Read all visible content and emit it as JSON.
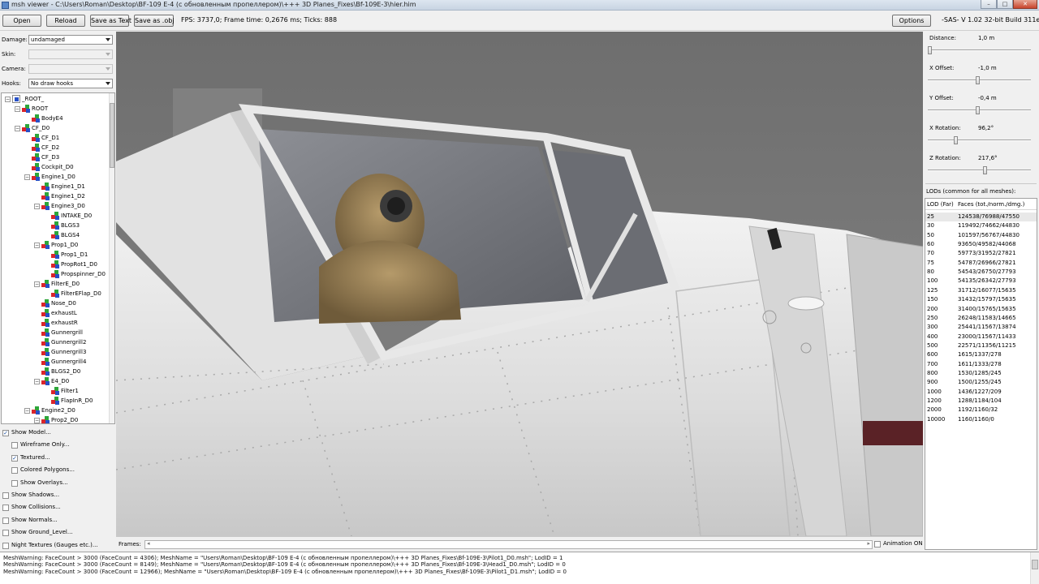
{
  "window": {
    "title": "msh viewer - C:\\Users\\Roman\\Desktop\\BF-109 E-4 (с обновленным пропеллером)\\+++ 3D Planes_Fixes\\Bf-109E-3\\hier.him",
    "minimize": "–",
    "maximize": "□",
    "close": "✕"
  },
  "toolbar": {
    "open": "Open",
    "reload": "Reload",
    "save_text": "Save as Text",
    "save_obj": "Save as .obj",
    "status": "FPS: 3737,0; Frame time: 0,2676 ms; Ticks: 888",
    "options": "Options",
    "build": "-SAS- V 1.02  32-bit  Build 311e"
  },
  "left": {
    "damage_label": "Damage:",
    "damage_value": "undamaged",
    "skin_label": "Skin:",
    "camera_label": "Camera:",
    "hooks_label": "Hooks:",
    "hooks_value": "No draw hooks",
    "tree": [
      {
        "label": "_ROOT_",
        "level": 0,
        "exp": "−",
        "root": true
      },
      {
        "label": "ROOT",
        "level": 1,
        "exp": "−"
      },
      {
        "label": "BodyE4",
        "level": 2,
        "exp": ""
      },
      {
        "label": "CF_D0",
        "level": 1,
        "exp": "−"
      },
      {
        "label": "CF_D1",
        "level": 2,
        "exp": ""
      },
      {
        "label": "CF_D2",
        "level": 2,
        "exp": ""
      },
      {
        "label": "CF_D3",
        "level": 2,
        "exp": ""
      },
      {
        "label": "Cockpit_D0",
        "level": 2,
        "exp": ""
      },
      {
        "label": "Engine1_D0",
        "level": 2,
        "exp": "−"
      },
      {
        "label": "Engine1_D1",
        "level": 3,
        "exp": ""
      },
      {
        "label": "Engine1_D2",
        "level": 3,
        "exp": ""
      },
      {
        "label": "Engine3_D0",
        "level": 3,
        "exp": "−"
      },
      {
        "label": "INTAKE_D0",
        "level": 4,
        "exp": ""
      },
      {
        "label": "BLGS3",
        "level": 4,
        "exp": ""
      },
      {
        "label": "BLGS4",
        "level": 4,
        "exp": ""
      },
      {
        "label": "Prop1_D0",
        "level": 3,
        "exp": "−"
      },
      {
        "label": "Prop1_D1",
        "level": 4,
        "exp": ""
      },
      {
        "label": "PropRot1_D0",
        "level": 4,
        "exp": ""
      },
      {
        "label": "Propspinner_D0",
        "level": 4,
        "exp": ""
      },
      {
        "label": "FilterE_D0",
        "level": 3,
        "exp": "−"
      },
      {
        "label": "FilterEFlap_D0",
        "level": 4,
        "exp": ""
      },
      {
        "label": "Nose_D0",
        "level": 3,
        "exp": ""
      },
      {
        "label": "exhaustL",
        "level": 3,
        "exp": ""
      },
      {
        "label": "exhaustR",
        "level": 3,
        "exp": ""
      },
      {
        "label": "Gunnergrill",
        "level": 3,
        "exp": ""
      },
      {
        "label": "Gunnergrill2",
        "level": 3,
        "exp": ""
      },
      {
        "label": "Gunnergrill3",
        "level": 3,
        "exp": ""
      },
      {
        "label": "Gunnergrill4",
        "level": 3,
        "exp": ""
      },
      {
        "label": "BLGS2_D0",
        "level": 3,
        "exp": ""
      },
      {
        "label": "E4_D0",
        "level": 3,
        "exp": "−"
      },
      {
        "label": "Filter1",
        "level": 4,
        "exp": ""
      },
      {
        "label": "FlapInR_D0",
        "level": 4,
        "exp": ""
      },
      {
        "label": "Engine2_D0",
        "level": 2,
        "exp": "−"
      },
      {
        "label": "Prop2_D0",
        "level": 3,
        "exp": "−"
      }
    ],
    "checks": [
      {
        "label": "Show Model...",
        "checked": true,
        "indent": 0
      },
      {
        "label": "Wireframe Only...",
        "checked": false,
        "indent": 1
      },
      {
        "label": "Textured...",
        "checked": true,
        "indent": 1
      },
      {
        "label": "Colored Polygons...",
        "checked": false,
        "indent": 1
      },
      {
        "label": "Show Overlays...",
        "checked": false,
        "indent": 1
      },
      {
        "label": "Show Shadows...",
        "checked": false,
        "indent": 0
      },
      {
        "label": "Show Collisions...",
        "checked": false,
        "indent": 0
      },
      {
        "label": "Show Normals...",
        "checked": false,
        "indent": 0
      },
      {
        "label": "Show Ground_Level...",
        "checked": false,
        "indent": 0
      },
      {
        "label": "Night Textures (Gauges etc.)...",
        "checked": false,
        "indent": 0
      }
    ]
  },
  "frames": {
    "label": "Frames:",
    "left_arrow": "◂",
    "right_arrow": "▸",
    "animation": "Animation ON",
    "animation_checked": false
  },
  "right": {
    "sliders": [
      {
        "label": "Distance:",
        "value": "1,0 m",
        "pos": 0.0
      },
      {
        "label": "X Offset:",
        "value": "-1,0 m",
        "pos": 0.48
      },
      {
        "label": "Y Offset:",
        "value": "-0,4 m",
        "pos": 0.48
      },
      {
        "label": "X Rotation:",
        "value": "96,2°",
        "pos": 0.26
      },
      {
        "label": "Z Rotation:",
        "value": "217,6°",
        "pos": 0.56
      }
    ],
    "lod_title": "LODs (common for all meshes):",
    "lod_col1": "LOD (Far)",
    "lod_col2": "Faces (tot./norm./dmg.)",
    "lods": [
      {
        "lod": "25",
        "faces": "124538/76988/47550"
      },
      {
        "lod": "30",
        "faces": "119492/74662/44830"
      },
      {
        "lod": "50",
        "faces": "101597/56767/44830"
      },
      {
        "lod": "60",
        "faces": "93650/49582/44068"
      },
      {
        "lod": "70",
        "faces": "59773/31952/27821"
      },
      {
        "lod": "75",
        "faces": "54787/26966/27821"
      },
      {
        "lod": "80",
        "faces": "54543/26750/27793"
      },
      {
        "lod": "100",
        "faces": "54135/26342/27793"
      },
      {
        "lod": "125",
        "faces": "31712/16077/15635"
      },
      {
        "lod": "150",
        "faces": "31432/15797/15635"
      },
      {
        "lod": "200",
        "faces": "31400/15765/15635"
      },
      {
        "lod": "250",
        "faces": "26248/11583/14665"
      },
      {
        "lod": "300",
        "faces": "25441/11567/13874"
      },
      {
        "lod": "400",
        "faces": "23000/11567/11433"
      },
      {
        "lod": "500",
        "faces": "22571/11356/11215"
      },
      {
        "lod": "600",
        "faces": "1615/1337/278"
      },
      {
        "lod": "700",
        "faces": "1611/1333/278"
      },
      {
        "lod": "800",
        "faces": "1530/1285/245"
      },
      {
        "lod": "900",
        "faces": "1500/1255/245"
      },
      {
        "lod": "1000",
        "faces": "1436/1227/209"
      },
      {
        "lod": "1200",
        "faces": "1288/1184/104"
      },
      {
        "lod": "2000",
        "faces": "1192/1160/32"
      },
      {
        "lod": "10000",
        "faces": "1160/1160/0"
      }
    ]
  },
  "console": [
    "MeshWarning: FaceCount > 3000 (FaceCount = 4306); MeshName = \"Users\\Roman\\Desktop\\BF-109 E-4 (с обновленным пропеллером)\\+++ 3D Planes_Fixes\\Bf-109E-3\\Pilot1_D0.msh\"; LodID = 1",
    "MeshWarning: FaceCount > 3000 (FaceCount = 8149); MeshName = \"Users\\Roman\\Desktop\\BF-109 E-4 (с обновленным пропеллером)\\+++ 3D Planes_Fixes\\Bf-109E-3\\Head1_D0.msh\"; LodID = 0",
    "MeshWarning: FaceCount > 3000 (FaceCount = 12966); MeshName = \"Users\\Roman\\Desktop\\BF-109 E-4 (с обновленным пропеллером)\\+++ 3D Planes_Fixes\\Bf-109E-3\\Pilot1_D1.msh\"; LodID = 0"
  ]
}
